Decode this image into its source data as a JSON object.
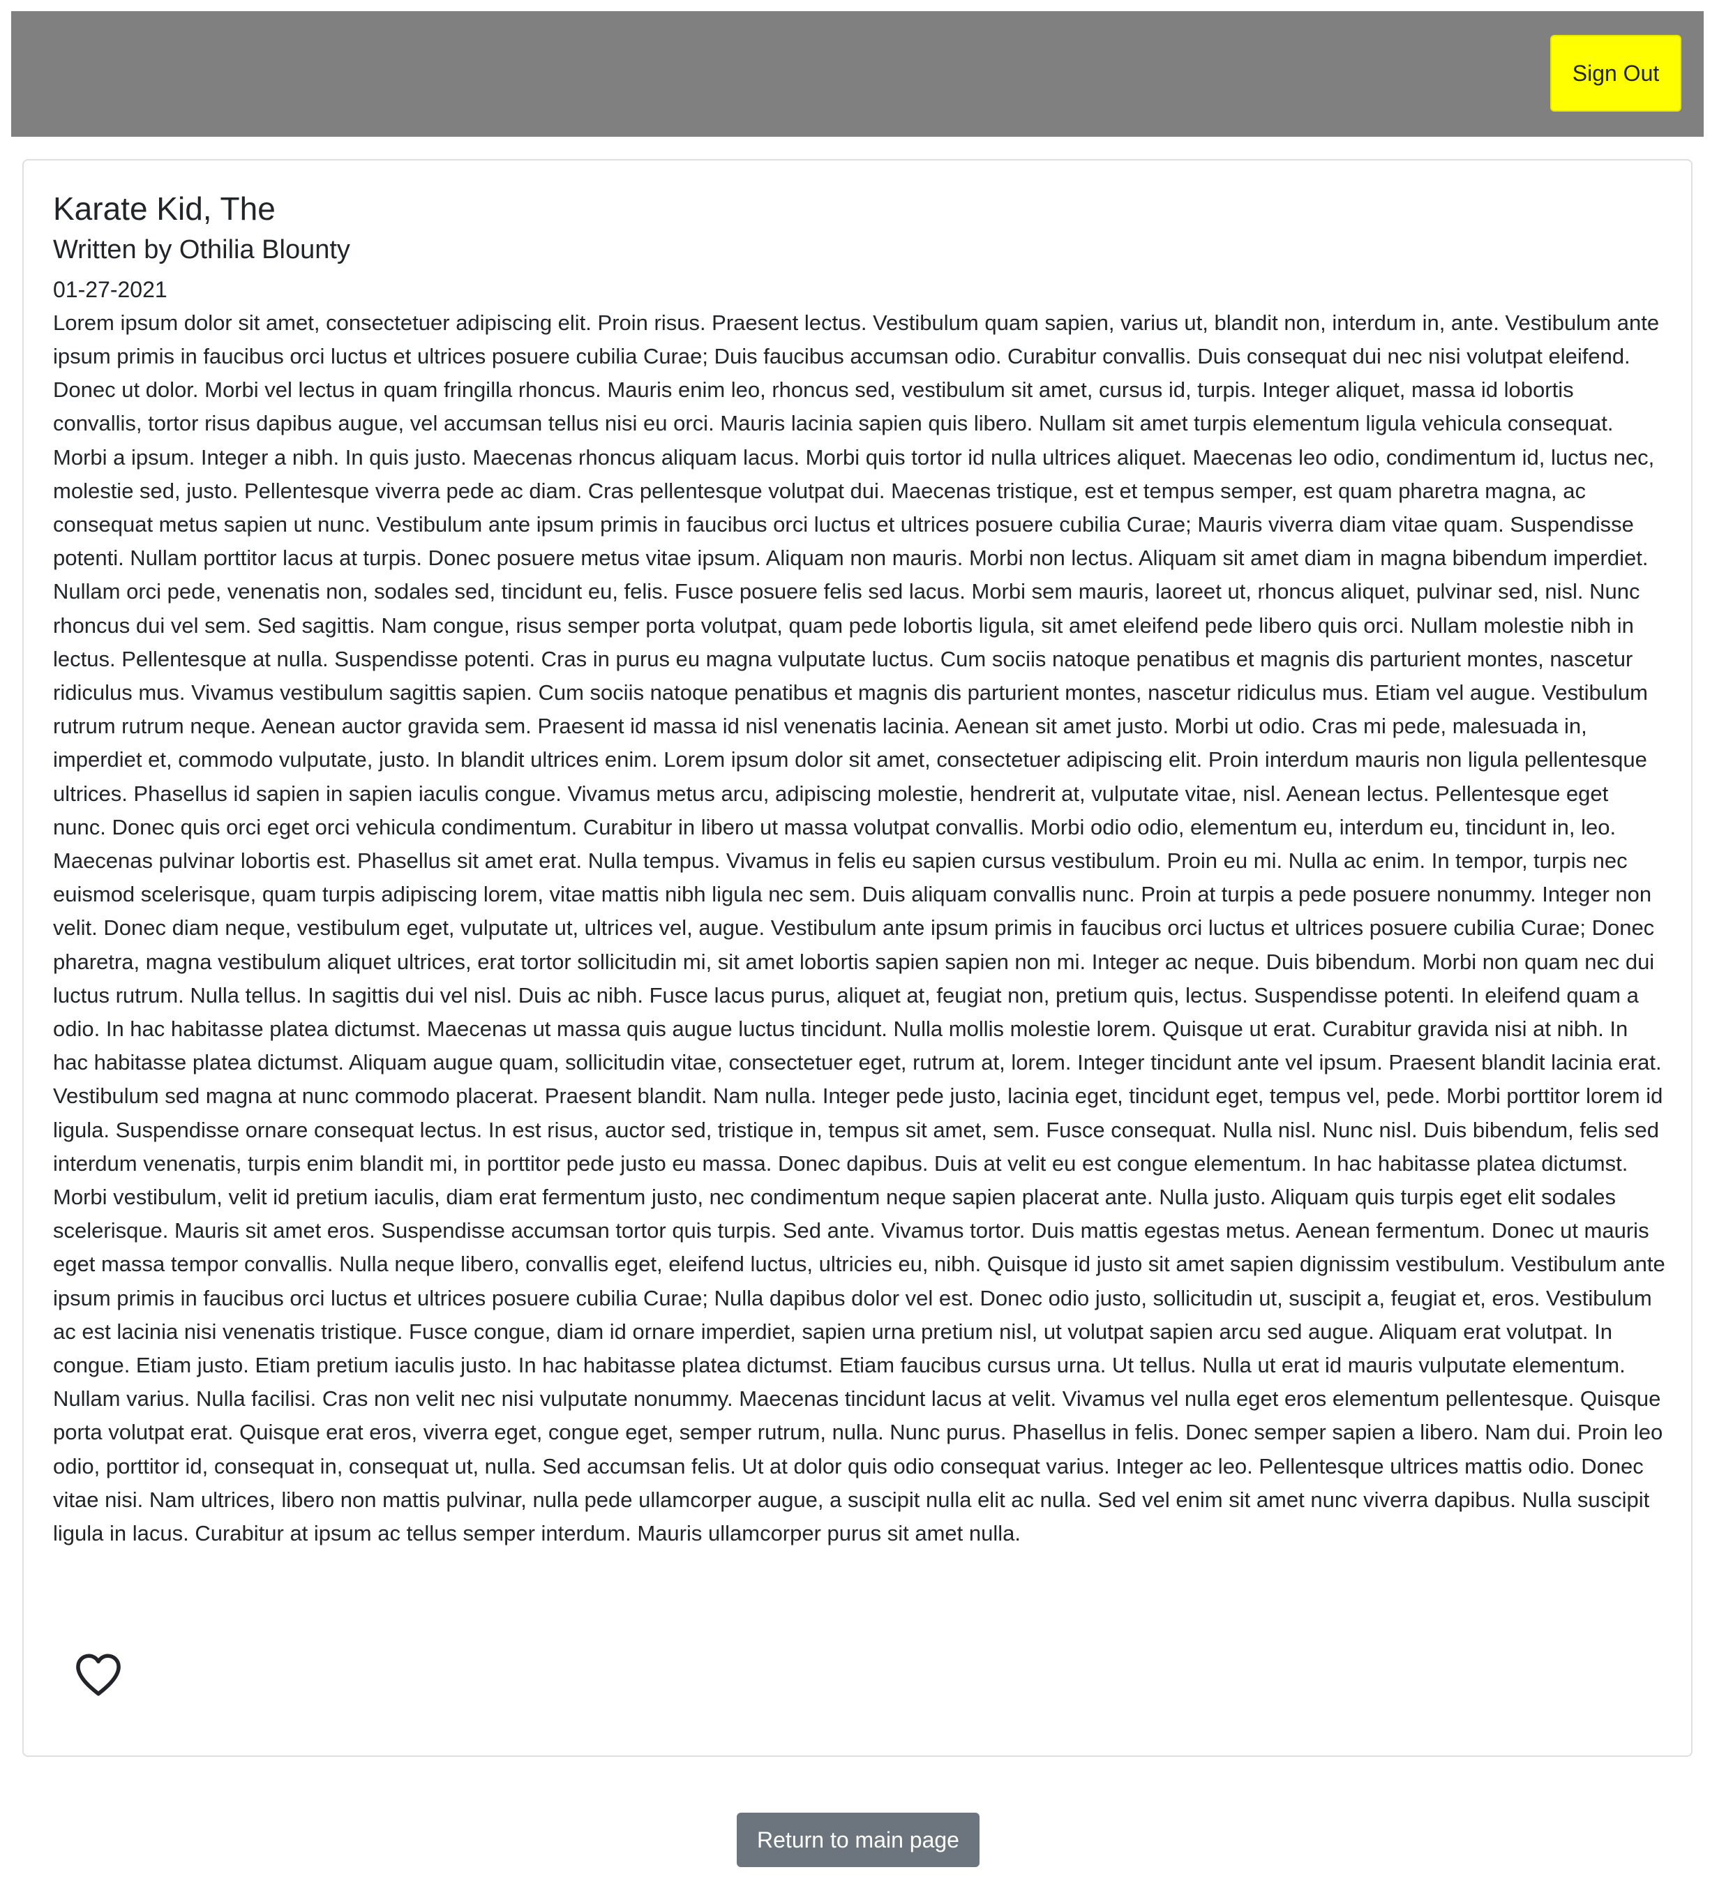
{
  "header": {
    "sign_out_label": "Sign Out"
  },
  "article": {
    "title": "Karate Kid, The",
    "author_line": "Written by Othilia Blounty",
    "date": "01-27-2021",
    "body": "Lorem ipsum dolor sit amet, consectetuer adipiscing elit. Proin risus. Praesent lectus. Vestibulum quam sapien, varius ut, blandit non, interdum in, ante. Vestibulum ante ipsum primis in faucibus orci luctus et ultrices posuere cubilia Curae; Duis faucibus accumsan odio. Curabitur convallis. Duis consequat dui nec nisi volutpat eleifend. Donec ut dolor. Morbi vel lectus in quam fringilla rhoncus. Mauris enim leo, rhoncus sed, vestibulum sit amet, cursus id, turpis. Integer aliquet, massa id lobortis convallis, tortor risus dapibus augue, vel accumsan tellus nisi eu orci. Mauris lacinia sapien quis libero. Nullam sit amet turpis elementum ligula vehicula consequat. Morbi a ipsum. Integer a nibh. In quis justo. Maecenas rhoncus aliquam lacus. Morbi quis tortor id nulla ultrices aliquet. Maecenas leo odio, condimentum id, luctus nec, molestie sed, justo. Pellentesque viverra pede ac diam. Cras pellentesque volutpat dui. Maecenas tristique, est et tempus semper, est quam pharetra magna, ac consequat metus sapien ut nunc. Vestibulum ante ipsum primis in faucibus orci luctus et ultrices posuere cubilia Curae; Mauris viverra diam vitae quam. Suspendisse potenti. Nullam porttitor lacus at turpis. Donec posuere metus vitae ipsum. Aliquam non mauris. Morbi non lectus. Aliquam sit amet diam in magna bibendum imperdiet. Nullam orci pede, venenatis non, sodales sed, tincidunt eu, felis. Fusce posuere felis sed lacus. Morbi sem mauris, laoreet ut, rhoncus aliquet, pulvinar sed, nisl. Nunc rhoncus dui vel sem. Sed sagittis. Nam congue, risus semper porta volutpat, quam pede lobortis ligula, sit amet eleifend pede libero quis orci. Nullam molestie nibh in lectus. Pellentesque at nulla. Suspendisse potenti. Cras in purus eu magna vulputate luctus. Cum sociis natoque penatibus et magnis dis parturient montes, nascetur ridiculus mus. Vivamus vestibulum sagittis sapien. Cum sociis natoque penatibus et magnis dis parturient montes, nascetur ridiculus mus. Etiam vel augue. Vestibulum rutrum rutrum neque. Aenean auctor gravida sem. Praesent id massa id nisl venenatis lacinia. Aenean sit amet justo. Morbi ut odio. Cras mi pede, malesuada in, imperdiet et, commodo vulputate, justo. In blandit ultrices enim. Lorem ipsum dolor sit amet, consectetuer adipiscing elit. Proin interdum mauris non ligula pellentesque ultrices. Phasellus id sapien in sapien iaculis congue. Vivamus metus arcu, adipiscing molestie, hendrerit at, vulputate vitae, nisl. Aenean lectus. Pellentesque eget nunc. Donec quis orci eget orci vehicula condimentum. Curabitur in libero ut massa volutpat convallis. Morbi odio odio, elementum eu, interdum eu, tincidunt in, leo. Maecenas pulvinar lobortis est. Phasellus sit amet erat. Nulla tempus. Vivamus in felis eu sapien cursus vestibulum. Proin eu mi. Nulla ac enim. In tempor, turpis nec euismod scelerisque, quam turpis adipiscing lorem, vitae mattis nibh ligula nec sem. Duis aliquam convallis nunc. Proin at turpis a pede posuere nonummy. Integer non velit. Donec diam neque, vestibulum eget, vulputate ut, ultrices vel, augue. Vestibulum ante ipsum primis in faucibus orci luctus et ultrices posuere cubilia Curae; Donec pharetra, magna vestibulum aliquet ultrices, erat tortor sollicitudin mi, sit amet lobortis sapien sapien non mi. Integer ac neque. Duis bibendum. Morbi non quam nec dui luctus rutrum. Nulla tellus. In sagittis dui vel nisl. Duis ac nibh. Fusce lacus purus, aliquet at, feugiat non, pretium quis, lectus. Suspendisse potenti. In eleifend quam a odio. In hac habitasse platea dictumst. Maecenas ut massa quis augue luctus tincidunt. Nulla mollis molestie lorem. Quisque ut erat. Curabitur gravida nisi at nibh. In hac habitasse platea dictumst. Aliquam augue quam, sollicitudin vitae, consectetuer eget, rutrum at, lorem. Integer tincidunt ante vel ipsum. Praesent blandit lacinia erat. Vestibulum sed magna at nunc commodo placerat. Praesent blandit. Nam nulla. Integer pede justo, lacinia eget, tincidunt eget, tempus vel, pede. Morbi porttitor lorem id ligula. Suspendisse ornare consequat lectus. In est risus, auctor sed, tristique in, tempus sit amet, sem. Fusce consequat. Nulla nisl. Nunc nisl. Duis bibendum, felis sed interdum venenatis, turpis enim blandit mi, in porttitor pede justo eu massa. Donec dapibus. Duis at velit eu est congue elementum. In hac habitasse platea dictumst. Morbi vestibulum, velit id pretium iaculis, diam erat fermentum justo, nec condimentum neque sapien placerat ante. Nulla justo. Aliquam quis turpis eget elit sodales scelerisque. Mauris sit amet eros. Suspendisse accumsan tortor quis turpis. Sed ante. Vivamus tortor. Duis mattis egestas metus. Aenean fermentum. Donec ut mauris eget massa tempor convallis. Nulla neque libero, convallis eget, eleifend luctus, ultricies eu, nibh. Quisque id justo sit amet sapien dignissim vestibulum. Vestibulum ante ipsum primis in faucibus orci luctus et ultrices posuere cubilia Curae; Nulla dapibus dolor vel est. Donec odio justo, sollicitudin ut, suscipit a, feugiat et, eros. Vestibulum ac est lacinia nisi venenatis tristique. Fusce congue, diam id ornare imperdiet, sapien urna pretium nisl, ut volutpat sapien arcu sed augue. Aliquam erat volutpat. In congue. Etiam justo. Etiam pretium iaculis justo. In hac habitasse platea dictumst. Etiam faucibus cursus urna. Ut tellus. Nulla ut erat id mauris vulputate elementum. Nullam varius. Nulla facilisi. Cras non velit nec nisi vulputate nonummy. Maecenas tincidunt lacus at velit. Vivamus vel nulla eget eros elementum pellentesque. Quisque porta volutpat erat. Quisque erat eros, viverra eget, congue eget, semper rutrum, nulla. Nunc purus. Phasellus in felis. Donec semper sapien a libero. Nam dui. Proin leo odio, porttitor id, consequat in, consequat ut, nulla. Sed accumsan felis. Ut at dolor quis odio consequat varius. Integer ac leo. Pellentesque ultrices mattis odio. Donec vitae nisi. Nam ultrices, libero non mattis pulvinar, nulla pede ullamcorper augue, a suscipit nulla elit ac nulla. Sed vel enim sit amet nunc viverra dapibus. Nulla suscipit ligula in lacus. Curabitur at ipsum ac tellus semper interdum. Mauris ullamcorper purus sit amet nulla."
  },
  "actions": {
    "like_icon": "heart-outline-icon",
    "return_label": "Return to main page"
  },
  "colors": {
    "header_bg": "#808080",
    "sign_out_bg": "#ffff00",
    "return_bg": "#6c757d",
    "text": "#212529"
  }
}
